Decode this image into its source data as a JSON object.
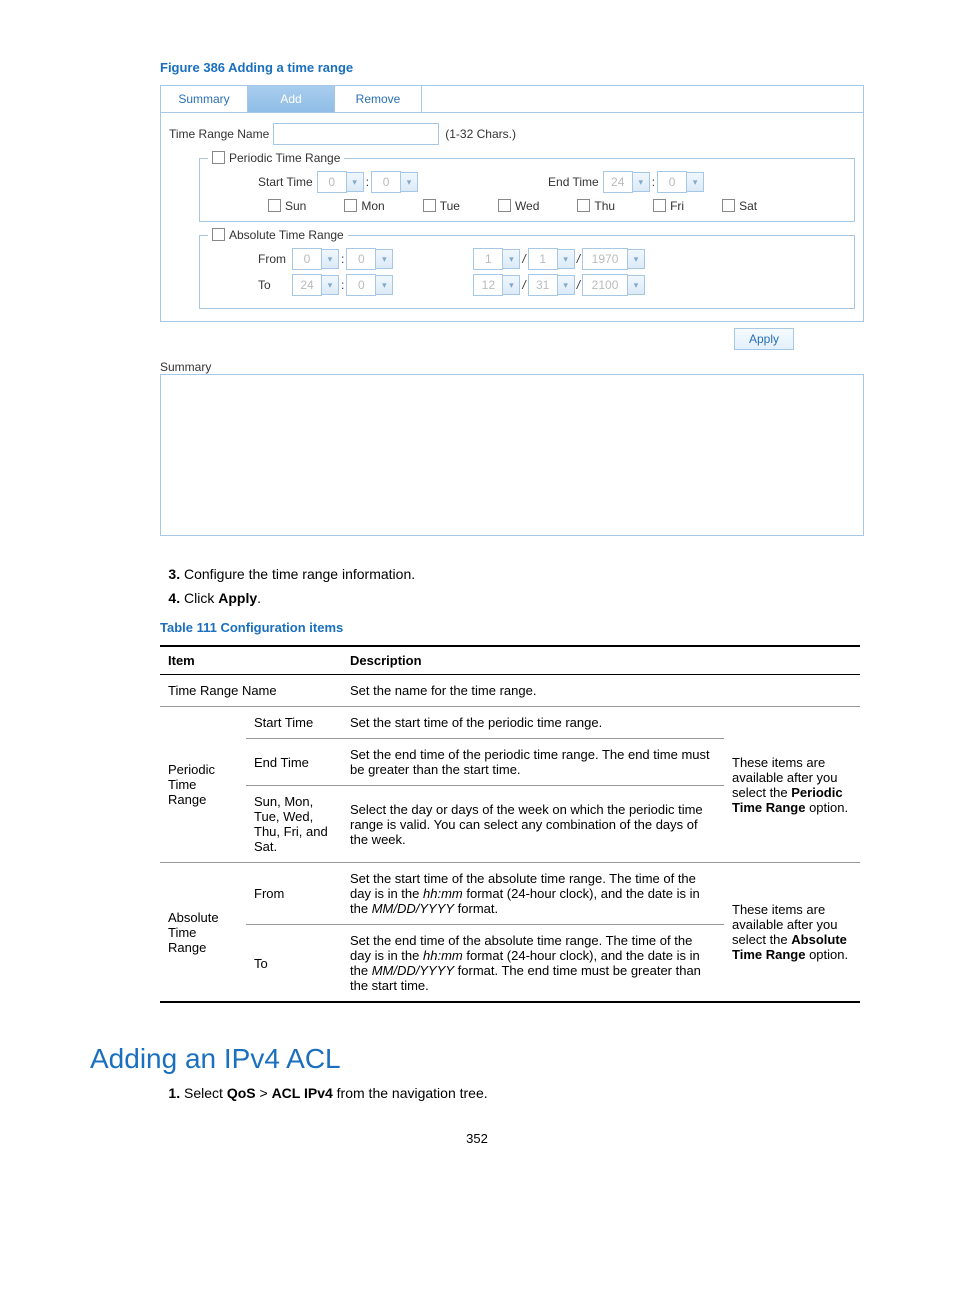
{
  "figure_caption": "Figure 386 Adding a time range",
  "tabs": {
    "summary": "Summary",
    "add": "Add",
    "remove": "Remove"
  },
  "form": {
    "time_range_name_label": "Time Range Name",
    "chars_hint": "(1-32 Chars.)",
    "periodic_legend": "Periodic Time Range",
    "start_time_label": "Start Time",
    "start_h": "0",
    "start_m": "0",
    "end_time_label": "End Time",
    "end_h": "24",
    "end_m": "0",
    "days": {
      "sun": "Sun",
      "mon": "Mon",
      "tue": "Tue",
      "wed": "Wed",
      "thu": "Thu",
      "fri": "Fri",
      "sat": "Sat"
    },
    "absolute_legend": "Absolute Time Range",
    "from_label": "From",
    "from_h": "0",
    "from_m": "0",
    "from_month": "1",
    "from_day": "1",
    "from_year": "1970",
    "to_label": "To",
    "to_h": "24",
    "to_m": "0",
    "to_month": "12",
    "to_day": "31",
    "to_year": "2100",
    "slash": "/",
    "colon": ":"
  },
  "apply_label": "Apply",
  "summary_heading": "Summary",
  "steps": {
    "s3": "Configure the time range information.",
    "s4_prefix": "Click ",
    "s4_bold": "Apply",
    "s4_suffix": "."
  },
  "table_caption": "Table 111 Configuration items",
  "table": {
    "h_item": "Item",
    "h_desc": "Description",
    "r1_item": "Time Range Name",
    "r1_desc": "Set the name for the time range.",
    "periodic_group": "Periodic Time Range",
    "p_start_item": "Start Time",
    "p_start_desc": "Set the start time of the periodic time range.",
    "p_end_item": "End Time",
    "p_end_desc": "Set the end time of the periodic time range. The end time must be greater than the start time.",
    "p_days_item": "Sun, Mon, Tue, Wed, Thu, Fri, and Sat.",
    "p_days_desc": "Select the day or days of the week on which the periodic time range is valid. You can select any combination of the days of the week.",
    "p_note_1": "These items are available after you select the ",
    "p_note_bold": "Periodic Time Range",
    "p_note_2": " option.",
    "absolute_group": "Absolute Time Range",
    "a_from_item": "From",
    "a_from_desc_1": "Set the start time of the absolute time range. The time of the day is in the ",
    "a_from_desc_italic": "hh:mm",
    "a_from_desc_2": " format (24-hour clock), and the date is in the ",
    "a_from_desc_italic2": "MM/DD/YYYY",
    "a_from_desc_3": " format.",
    "a_to_item": "To",
    "a_to_desc_1": "Set the end time of the absolute time range. The time of the day is in the ",
    "a_to_desc_italic": "hh:mm",
    "a_to_desc_2": " format (24-hour clock), and the date is in the ",
    "a_to_desc_italic2": "MM/DD/YYYY",
    "a_to_desc_3": " format. The end time must be greater than the start time.",
    "a_note_1": "These items are available after you select the ",
    "a_note_bold": "Absolute Time Range",
    "a_note_2": " option."
  },
  "section_heading": "Adding an IPv4 ACL",
  "nav_step_prefix": "Select ",
  "nav_step_bold1": "QoS",
  "nav_step_mid": " > ",
  "nav_step_bold2": "ACL IPv4",
  "nav_step_suffix": " from the navigation tree.",
  "page_number": "352"
}
